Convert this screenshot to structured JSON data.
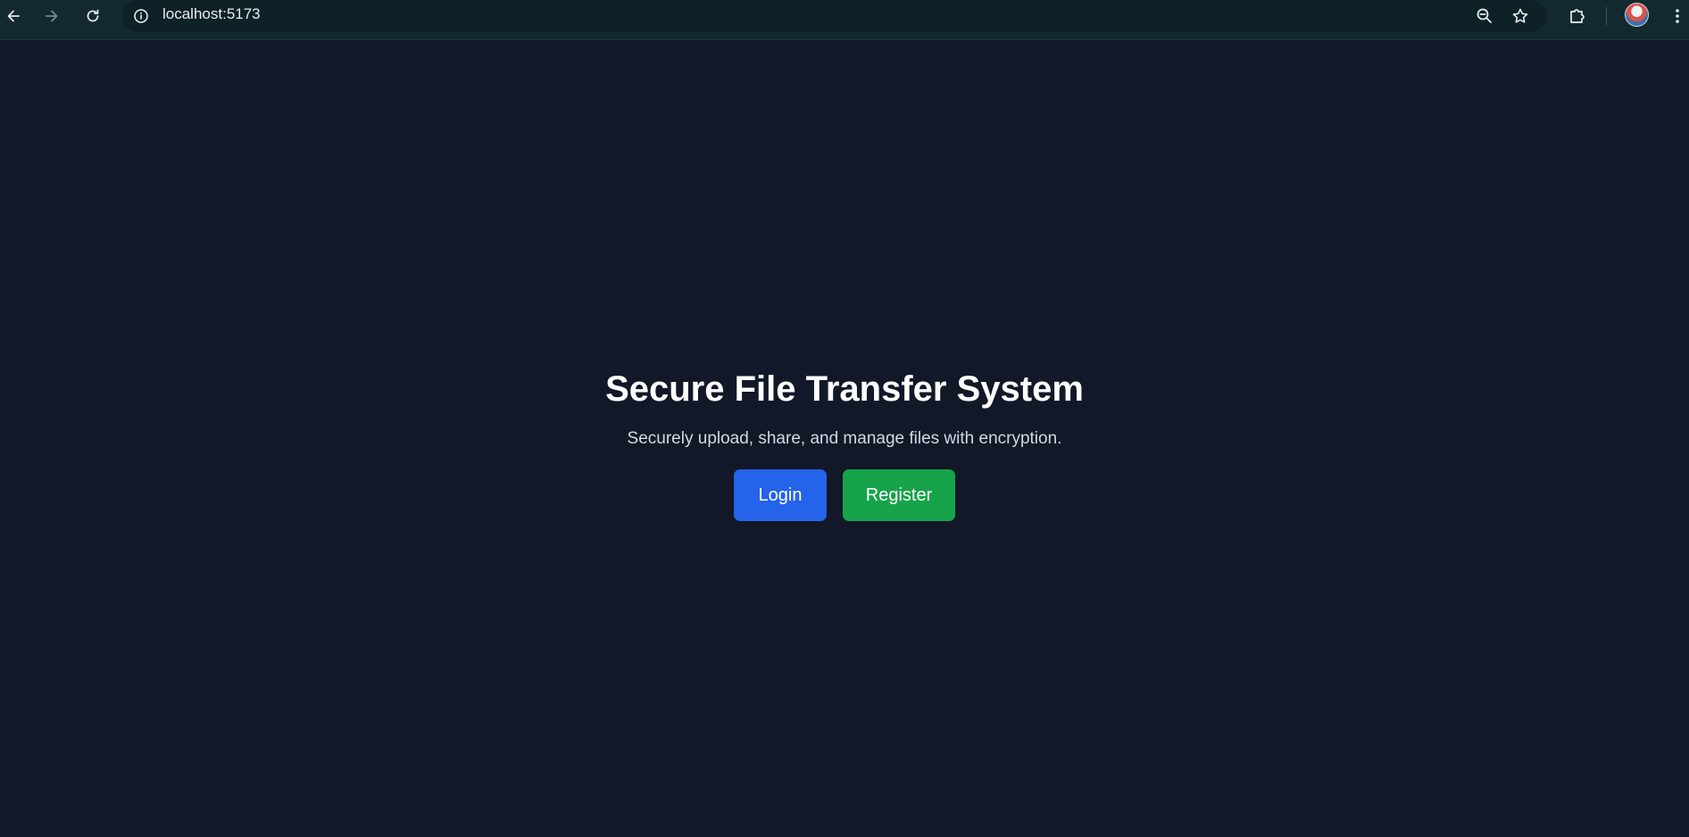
{
  "browser": {
    "url": "localhost:5173",
    "icons": {
      "back": "arrow-left-icon",
      "forward": "arrow-right-icon",
      "reload": "reload-icon",
      "site_info": "info-icon",
      "zoom": "zoom-out-icon",
      "bookmark": "star-icon",
      "extensions": "puzzle-icon",
      "menu": "kebab-menu-icon"
    }
  },
  "hero": {
    "title": "Secure File Transfer System",
    "subtitle": "Securely upload, share, and manage files with encryption.",
    "login_label": "Login",
    "register_label": "Register"
  },
  "colors": {
    "page_background": "#121827",
    "browser_bar": "#122a2f",
    "login_button": "#2563eb",
    "register_button": "#16a34a"
  }
}
